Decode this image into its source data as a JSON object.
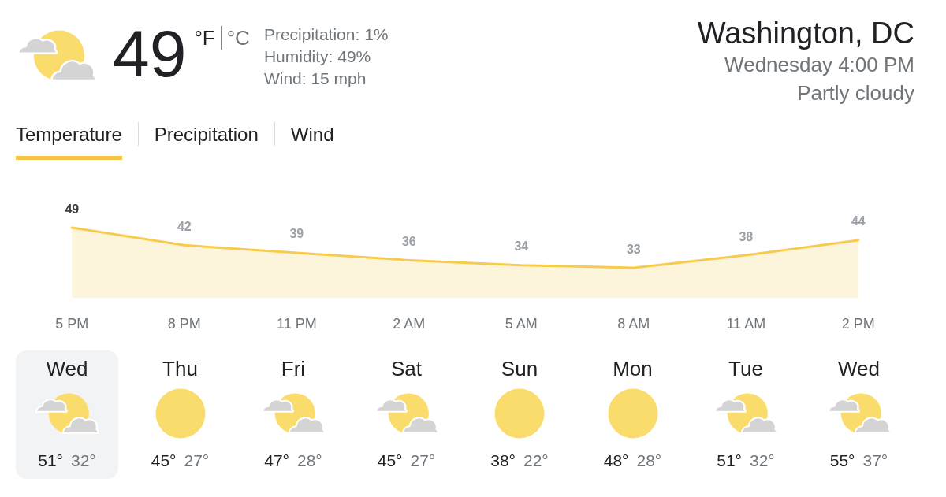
{
  "current": {
    "kind": "partly-cloudy",
    "temperature": "49",
    "units": [
      {
        "label": "°F",
        "selected": true
      },
      {
        "label": "°C",
        "selected": false
      }
    ],
    "details": [
      "Precipitation: 1%",
      "Humidity: 49%",
      "Wind: 15 mph"
    ]
  },
  "location": {
    "name": "Washington, DC",
    "time": "Wednesday 4:00 PM",
    "condition": "Partly cloudy"
  },
  "tabs": [
    {
      "label": "Temperature",
      "selected": true
    },
    {
      "label": "Precipitation",
      "selected": false
    },
    {
      "label": "Wind",
      "selected": false
    }
  ],
  "chart": {
    "chart_data": {
      "type": "area",
      "categories": [
        "5 PM",
        "8 PM",
        "11 PM",
        "2 AM",
        "5 AM",
        "8 AM",
        "11 AM",
        "2 PM"
      ],
      "values": [
        49,
        42,
        39,
        36,
        34,
        33,
        38,
        44
      ],
      "color": "#f7cb4d",
      "data_labels": true
    }
  },
  "days": [
    {
      "day": "Wed",
      "kind": "partly-cloudy",
      "high": "51°",
      "low": "32°",
      "selected": true
    },
    {
      "day": "Thu",
      "kind": "sunny",
      "high": "45°",
      "low": "27°",
      "selected": false
    },
    {
      "day": "Fri",
      "kind": "partly-cloudy",
      "high": "47°",
      "low": "28°",
      "selected": false
    },
    {
      "day": "Sat",
      "kind": "partly-cloudy",
      "high": "45°",
      "low": "27°",
      "selected": false
    },
    {
      "day": "Sun",
      "kind": "sunny",
      "high": "38°",
      "low": "22°",
      "selected": false
    },
    {
      "day": "Mon",
      "kind": "sunny",
      "high": "48°",
      "low": "28°",
      "selected": false
    },
    {
      "day": "Tue",
      "kind": "partly-cloudy",
      "high": "51°",
      "low": "32°",
      "selected": false
    },
    {
      "day": "Wed",
      "kind": "partly-cloudy",
      "high": "55°",
      "low": "37°",
      "selected": false
    }
  ]
}
